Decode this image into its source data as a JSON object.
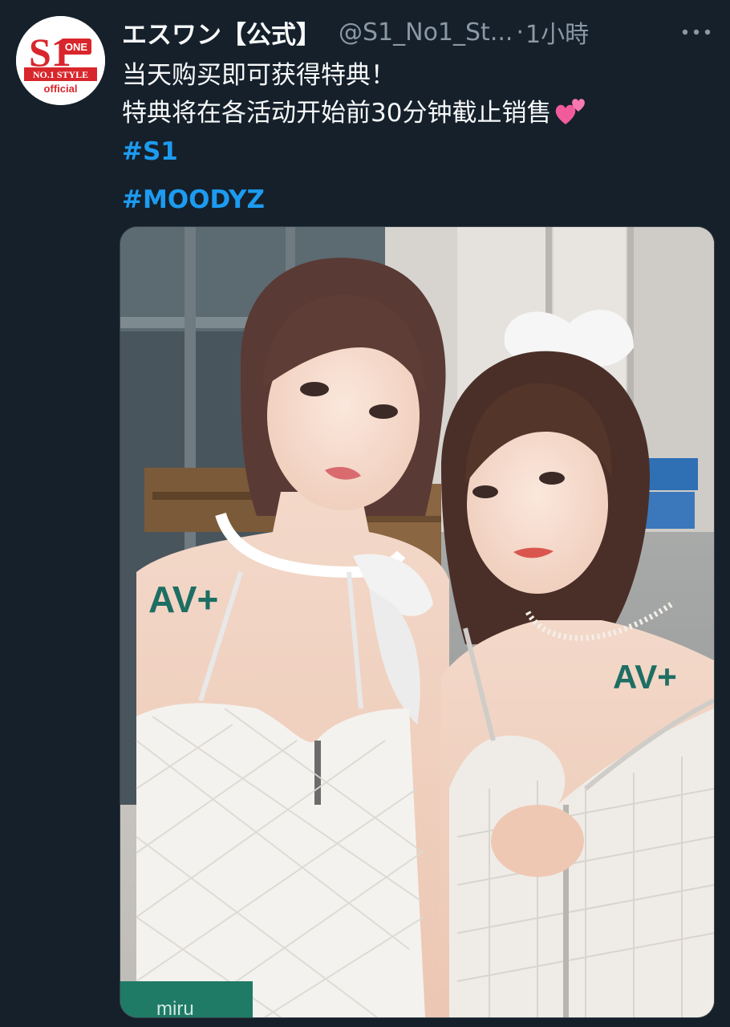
{
  "tweet": {
    "display_name": "エスワン【公式】",
    "handle": "@S1_No1_St...",
    "separator": "·",
    "timestamp": "1小時",
    "lines": [
      "当天购买即可获得特典！",
      "特典将在各活动开始前30分钟截止销售"
    ],
    "emoji": "two-hearts",
    "hashtags": [
      "#S1",
      "#MOODYZ"
    ]
  },
  "avatar": {
    "logo_main": "S1",
    "logo_one": "ONE",
    "logo_style": "NO.1 STYLE",
    "logo_official": "official"
  },
  "media": {
    "description": "photo",
    "body_mark_left": "AV+",
    "body_mark_right": "AV+",
    "partial_label": "miru"
  },
  "colors": {
    "background": "#15202b",
    "text_primary": "#f7f9f9",
    "text_secondary": "#8b98a5",
    "link": "#1d9bf0",
    "logo_red": "#d8262c"
  }
}
